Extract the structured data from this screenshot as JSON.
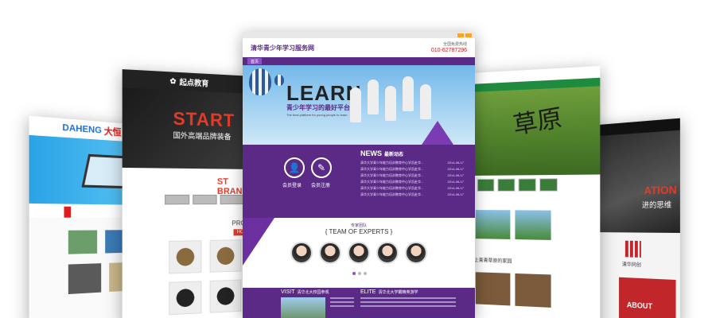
{
  "card1": {
    "logo_en": "DAHENG",
    "logo_cn": "大恒",
    "nav_active": "",
    "nav_item": ""
  },
  "card2": {
    "top_logo": "起点教育",
    "hero_title": "START",
    "hero_sub": "国外高端品牌装备",
    "brand_text": "BRAND",
    "brand_prefix": "ST",
    "products_label": "PROD",
    "hot_label": "HOT"
  },
  "card3": {
    "brand_name": "清华青少年学习服务网",
    "phone_label": "全国免费热线",
    "phone": "010-62787296",
    "nav": [
      "首页",
      "",
      "",
      "",
      "",
      "",
      "",
      ""
    ],
    "hero_title": "LEARN",
    "hero_slogan": "青少年学习的最好平台",
    "hero_tagline": "The best platform for young people to learn",
    "left_btn1": "会员登录",
    "left_btn2": "会员注册",
    "news_title": "NEWS",
    "news_sub": "最新动态",
    "news_items": [
      {
        "text": "清华大学青少年能力培训教育中心学员赴华...",
        "date": "2014-06-17"
      },
      {
        "text": "清华大学青少年能力培训教育中心学员赴华...",
        "date": "2014-06-17"
      },
      {
        "text": "清华大学青少年能力培训教育中心学员赴华...",
        "date": "2014-06-17"
      },
      {
        "text": "清华大学青少年能力培训教育中心学员赴华...",
        "date": "2014-06-17"
      },
      {
        "text": "清华大学青少年能力培训教育中心学员赴华...",
        "date": "2014-06-17"
      },
      {
        "text": "清华大学青少年能力培训教育中心学员赴华...",
        "date": "2014-06-17"
      }
    ],
    "team_cn": "专家团队",
    "team_en": "{ TEAM OF EXPERTS }",
    "visit_title": "VISIT",
    "visit_sub": "清华北大校园参观",
    "elite_title": "ELITE",
    "elite_sub": "清华北大学霸精英游学"
  },
  "card4": {
    "calligraphy": "草原",
    "caption": "爱上青青草原的家园"
  },
  "card5": {
    "hero_red": "ATION",
    "hero_white": "进的思维",
    "logo_text": "清华同创",
    "about": "ABOUT"
  }
}
